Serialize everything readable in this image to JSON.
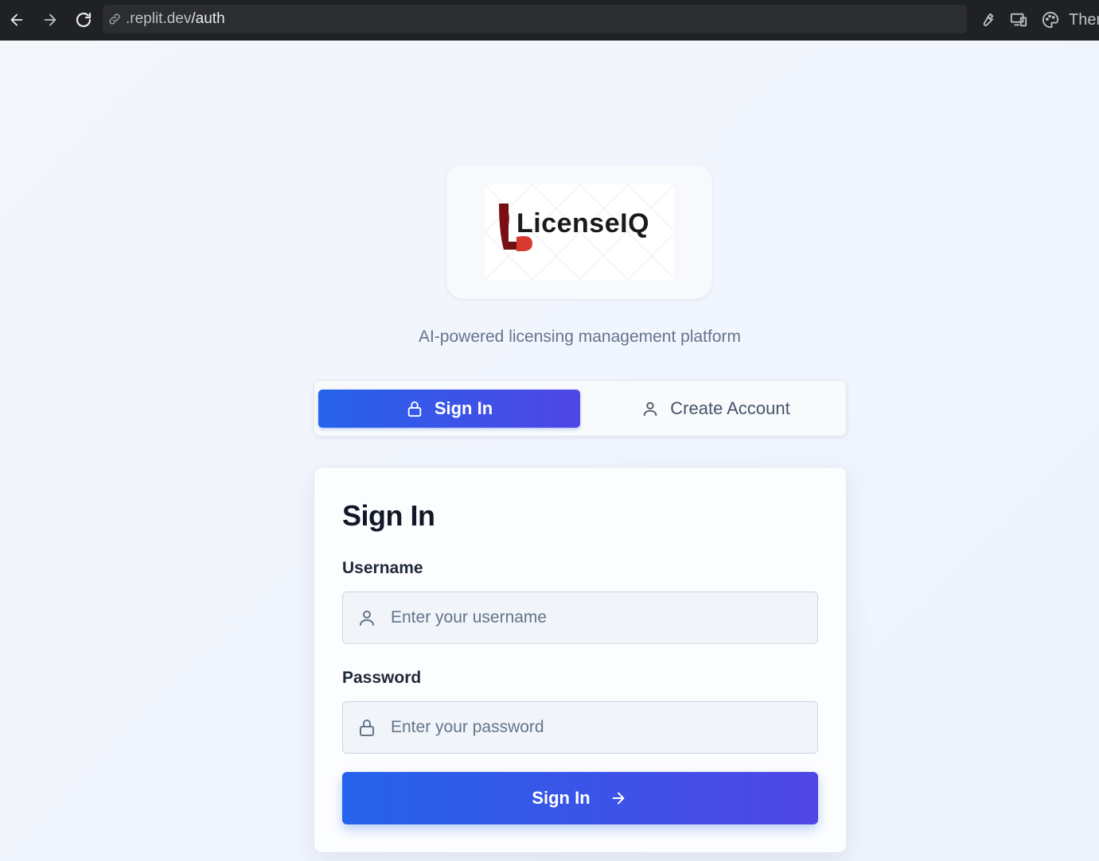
{
  "browser": {
    "url_domain": ".replit.dev",
    "url_path": "/auth",
    "theme_label": "Ther"
  },
  "logo": {
    "brand_text": "LicenseIQ",
    "icon": "licenseiq-logo"
  },
  "tagline": "AI-powered licensing management platform",
  "tabs": [
    {
      "label": "Sign In",
      "icon": "lock-icon",
      "active": true
    },
    {
      "label": "Create Account",
      "icon": "user-icon",
      "active": false
    }
  ],
  "form": {
    "title": "Sign In",
    "username": {
      "label": "Username",
      "placeholder": "Enter your username",
      "value": ""
    },
    "password": {
      "label": "Password",
      "placeholder": "Enter your password",
      "value": ""
    },
    "submit_label": "Sign In"
  },
  "colors": {
    "accent_start": "#2563eb",
    "accent_end": "#4f46e5",
    "browser_bg": "#202124"
  }
}
